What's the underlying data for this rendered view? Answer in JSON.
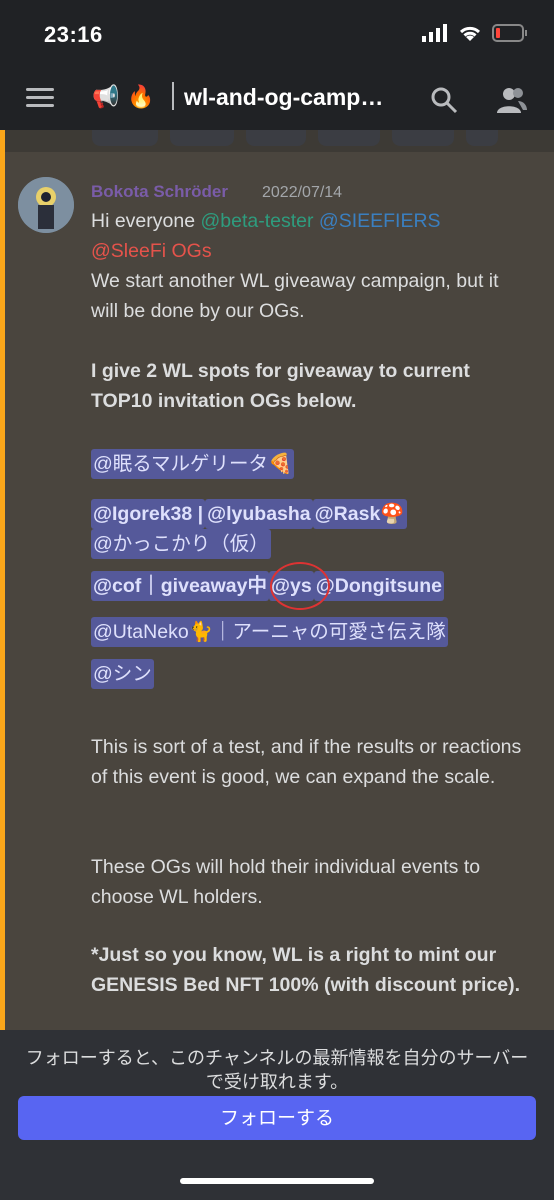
{
  "status": {
    "time": "23:16"
  },
  "header": {
    "channel_title": "wl-and-og-camp…",
    "icons": [
      "megaphone-icon",
      "fire-icon"
    ]
  },
  "message": {
    "author": "Bokota Schröder",
    "date": "2022/07/14",
    "greeting": "Hi everyone ",
    "mention_beta": "@beta-tester",
    "mention_sleefiers": "@SIEEFIERS",
    "mention_ogs": "@SleeFi OGs",
    "p1": "We start another WL giveaway campaign, but it will be done by our OGs.",
    "p2": "I give 2 WL spots for giveaway to current TOP10 invitation OGs below.",
    "og1": "@眠るマルゲリータ🍕",
    "og2a": "@Igorek38 |",
    "og2b": "@lyubasha",
    "og2c": "@Rask🍄",
    "og3": "@かっこかり（仮）",
    "og4a": "@cof｜giveaway中",
    "og4b": "@ys",
    "og4c": "@Dongitsune",
    "og5": "@UtaNeko🐈｜アーニャの可愛さ伝え隊",
    "og6": "@シン",
    "p3": "This is sort of a test, and if the results or reactions of this event is good, we can expand the scale.",
    "p4": "These OGs will hold their individual events to choose WL holders.",
    "p5": "*Just so you know, WL is a right to mint our GENESIS Bed NFT 100% (with discount price)."
  },
  "footer": {
    "notice": "フォローすると、このチャンネルの最新情報を自分のサーバーで受け取れます。",
    "follow_label": "フォローする"
  },
  "colors": {
    "accent": "#5865f2",
    "bar": "#faa61a",
    "author": "#7a5ca8"
  }
}
